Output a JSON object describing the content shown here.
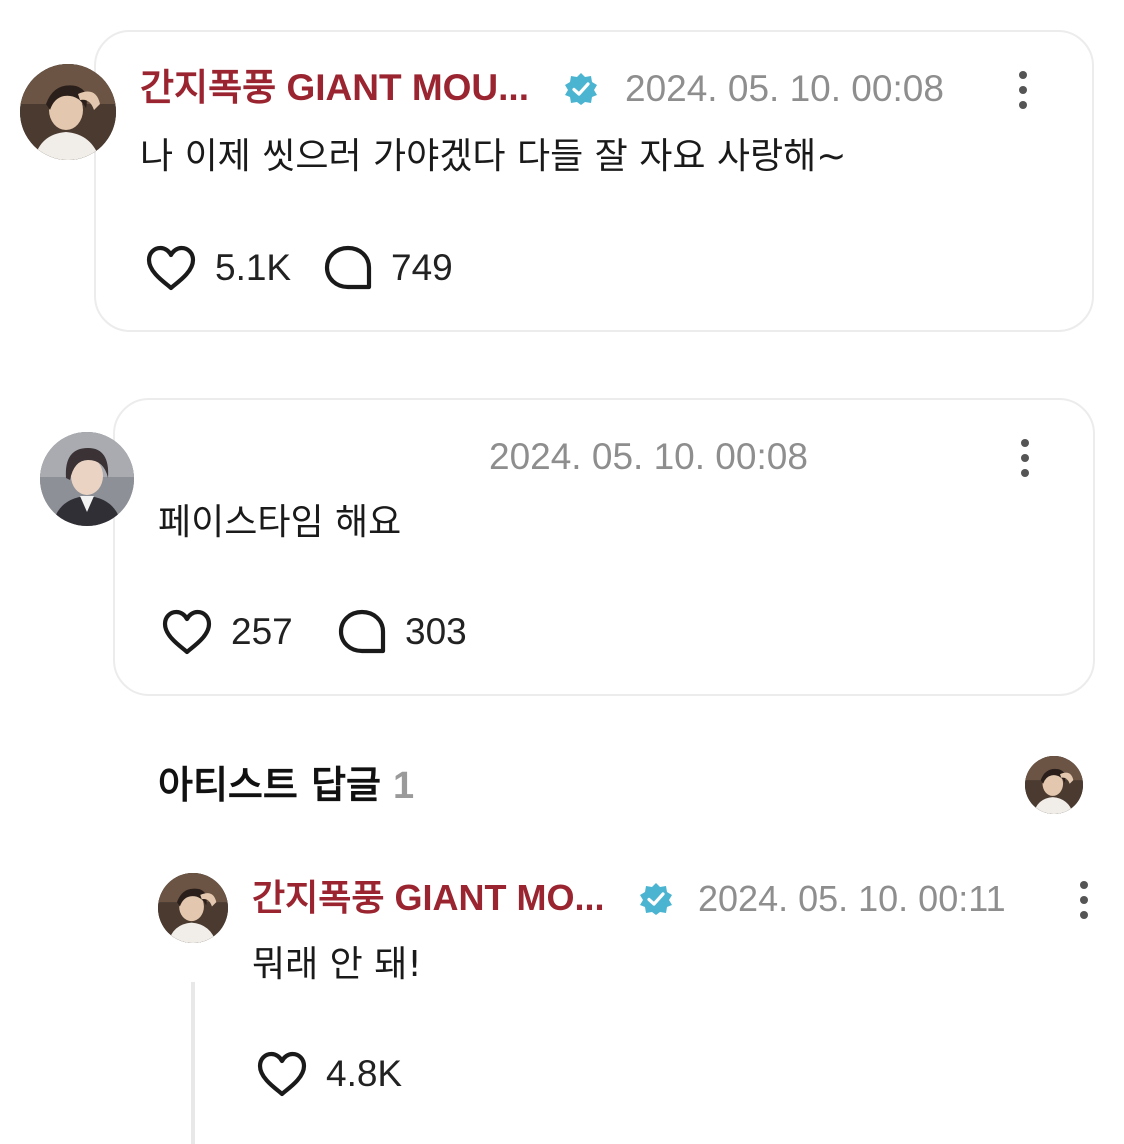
{
  "posts": [
    {
      "author": "간지폭풍 GIANT MOU...",
      "verified": true,
      "timestamp": "2024. 05. 10. 00:08",
      "text": "나 이제 씻으러 가야겠다 다들 잘 자요 사랑해~",
      "likes": "5.1K",
      "comments": "749",
      "like_icon": "heart-icon",
      "comment_icon": "comment-bubble-icon"
    },
    {
      "author": "",
      "verified": false,
      "timestamp": "2024. 05. 10. 00:08",
      "text": "페이스타임 해요",
      "likes": "257",
      "comments": "303",
      "like_icon": "heart-icon",
      "comment_icon": "comment-bubble-icon"
    }
  ],
  "artist_replies": {
    "title": "아티스트 답글",
    "count": "1"
  },
  "reply": {
    "author": "간지폭풍 GIANT MO...",
    "verified": true,
    "timestamp": "2024. 05. 10. 00:11",
    "text": "뭐래 안 돼!",
    "likes": "4.8K",
    "like_icon": "heart-icon"
  },
  "colors": {
    "author_name": "#9a2530",
    "verified_badge": "#4ab4d1",
    "timestamp": "#8e8e8e",
    "card_border": "#ececec"
  }
}
